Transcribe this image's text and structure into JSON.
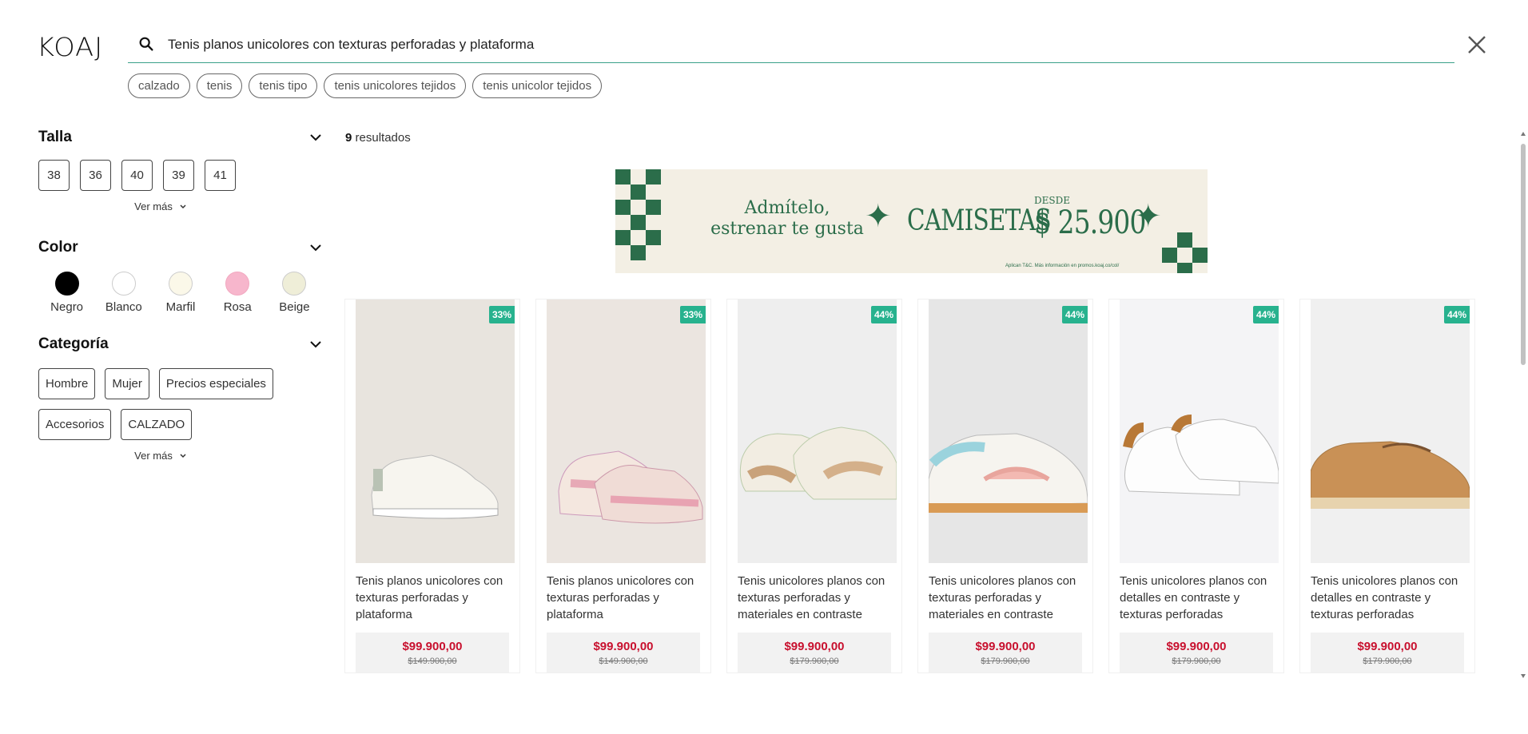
{
  "header": {
    "logo": "KOAJ",
    "search_value": "Tenis planos unicolores con texturas perforadas y plataforma"
  },
  "suggestions": [
    "calzado",
    "tenis",
    "tenis tipo",
    "tenis unicolores tejidos",
    "tenis unicolor tejidos"
  ],
  "filters": {
    "size": {
      "title": "Talla",
      "options": [
        "38",
        "36",
        "40",
        "39",
        "41"
      ],
      "more": "Ver más"
    },
    "color": {
      "title": "Color",
      "options": [
        {
          "label": "Negro",
          "hex": "#000000"
        },
        {
          "label": "Blanco",
          "hex": "#ffffff"
        },
        {
          "label": "Marfil",
          "hex": "#fbf8e9"
        },
        {
          "label": "Rosa",
          "hex": "#f7b6cc"
        },
        {
          "label": "Beige",
          "hex": "#efeed8"
        }
      ]
    },
    "category": {
      "title": "Categoría",
      "options": [
        "Hombre",
        "Mujer",
        "Precios especiales",
        "Accesorios",
        "CALZADO"
      ],
      "more": "Ver más"
    }
  },
  "results": {
    "count": "9",
    "label": "resultados"
  },
  "banner": {
    "line1": "Admítelo,",
    "line2": "estrenar te gusta",
    "headline": "CAMISETAS",
    "desde": "DESDE",
    "price": "$ 25.900",
    "fine_print": "Aplican T&C. Más información en promos.koaj.co/col/"
  },
  "products": [
    {
      "badge": "33%",
      "title": "Tenis planos unicolores con texturas perforadas y plataforma",
      "price": "$99.900,00",
      "old_price": "$149.900,00"
    },
    {
      "badge": "33%",
      "title": "Tenis planos unicolores con texturas perforadas y plataforma",
      "price": "$99.900,00",
      "old_price": "$149.900,00"
    },
    {
      "badge": "44%",
      "title": "Tenis unicolores planos con texturas perforadas y materiales en contraste",
      "price": "$99.900,00",
      "old_price": "$179.900,00"
    },
    {
      "badge": "44%",
      "title": "Tenis unicolores planos con texturas perforadas y materiales en contraste",
      "price": "$99.900,00",
      "old_price": "$179.900,00"
    },
    {
      "badge": "44%",
      "title": "Tenis unicolores planos con detalles en contraste y texturas perforadas",
      "price": "$99.900,00",
      "old_price": "$179.900,00"
    },
    {
      "badge": "44%",
      "title": "Tenis unicolores planos con detalles en contraste y texturas perforadas",
      "price": "$99.900,00",
      "old_price": "$179.900,00"
    }
  ],
  "colors": {
    "accent": "#27b28e",
    "price_red": "#c8102e",
    "banner_green": "#2b6d4a"
  }
}
